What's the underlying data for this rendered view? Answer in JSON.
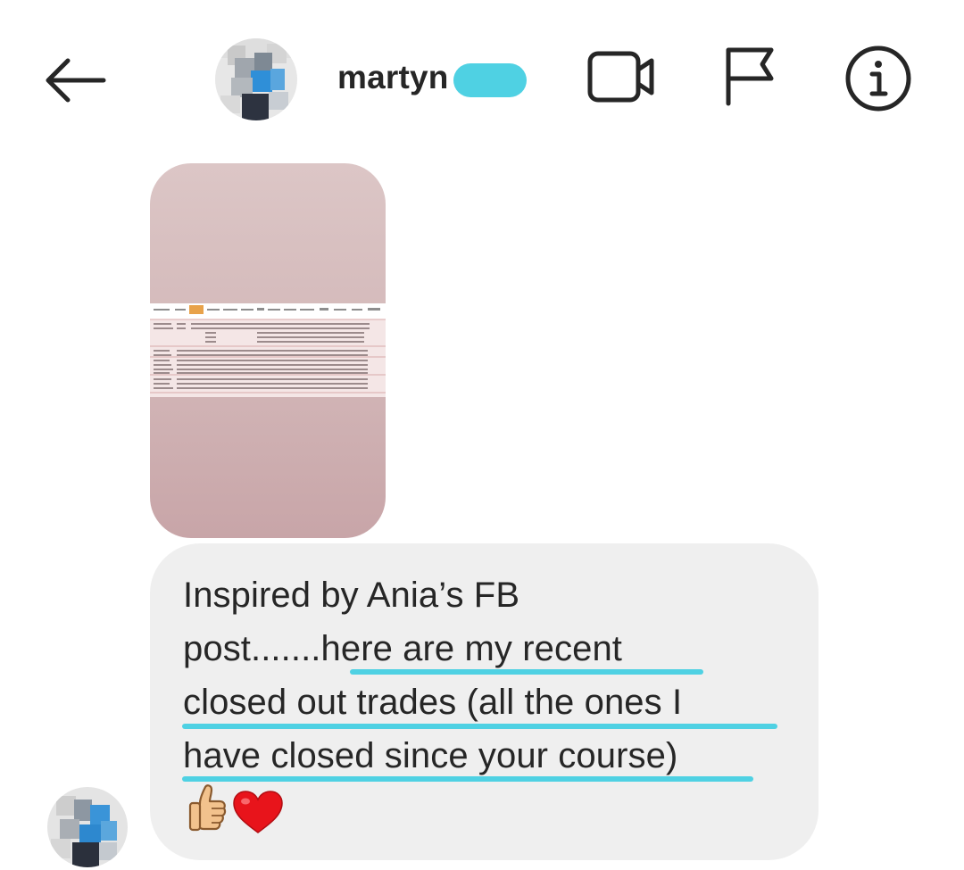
{
  "header": {
    "back_icon": "arrow-left-icon",
    "username": "martyn",
    "icons": [
      "video-camera-icon",
      "flag-icon",
      "info-icon"
    ]
  },
  "thread": {
    "attachment": {
      "kind": "spreadsheet-image"
    },
    "message": {
      "lines": [
        "Inspired by Ania’s FB",
        "post.......here are my recent",
        "closed out trades (all the ones I",
        "have closed since your course)"
      ],
      "emojis": [
        "thumbs-up-icon",
        "red-heart-icon"
      ]
    }
  },
  "colors": {
    "highlight": "#4fd1e3",
    "bubble": "#efefef",
    "text": "#262626"
  }
}
